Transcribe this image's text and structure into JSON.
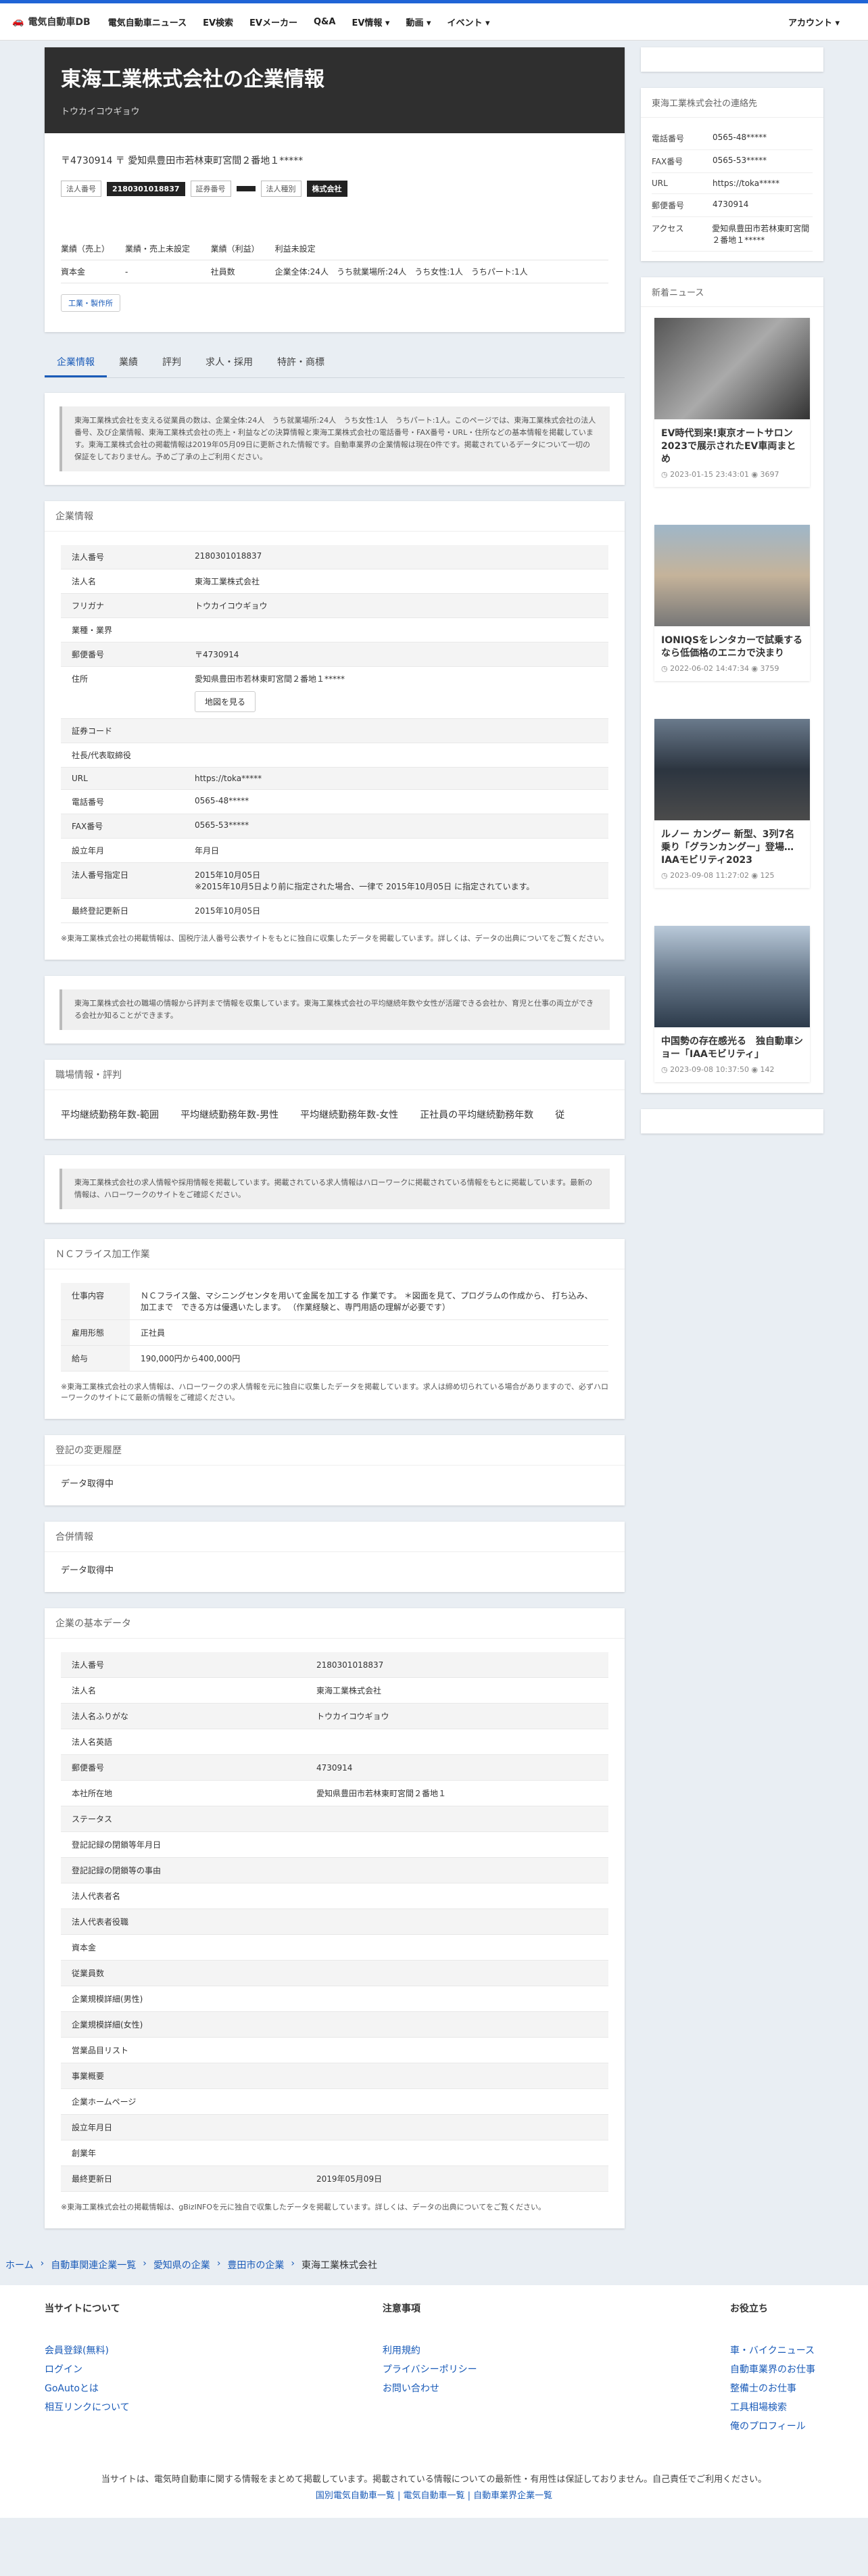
{
  "nav": {
    "brand": "電気自動車DB",
    "items": [
      "電気自動車ニュース",
      "EV検索",
      "EVメーカー",
      "Q&A",
      "EV情報 ▾",
      "動画 ▾",
      "イベント ▾"
    ],
    "account": "アカウント ▾"
  },
  "hero": {
    "title": "東海工業株式会社の企業情報",
    "kana": "トウカイコウギョウ"
  },
  "company_summary": {
    "address": "〒4730914 〒 愛知県豊田市若林東町宮間２番地１*****",
    "badges": [
      {
        "label": "法人番号",
        "value": "2180301018837"
      },
      {
        "label": "証券番号",
        "value": ""
      },
      {
        "label": "法人種別",
        "value": "株式会社"
      }
    ],
    "rows": [
      [
        "業績（売上）",
        "業績・売上未設定",
        "業績（利益）",
        "利益未設定"
      ],
      [
        "資本金",
        "-",
        "社員数",
        "企業全体:24人　うち就業場所:24人　うち女性:1人　うちパート:1人"
      ]
    ],
    "tag": "工業・製作所"
  },
  "tabs": [
    "企業情報",
    "業績",
    "評判",
    "求人・採用",
    "特許・商標"
  ],
  "notice1": "東海工業株式会社を支える従業員の数は、企業全体:24人　うち就業場所:24人　うち女性:1人　うちパート:1人。このページでは、東海工業株式会社の法人番号、及び企業情報、東海工業株式会社の売上・利益などの決算情報と東海工業株式会社の電話番号・FAX番号・URL・住所などの基本情報を掲載しています。東海工業株式会社の掲載情報は2019年05月09日に更新された情報です。自動車業界の企業情報は現在0件です。掲載されているデータについて一切の保証をしておりません。予めご了承の上ご利用ください。",
  "company_info": {
    "heading": "企業情報",
    "rows": [
      [
        "法人番号",
        "2180301018837"
      ],
      [
        "法人名",
        "東海工業株式会社"
      ],
      [
        "フリガナ",
        "トウカイコウギョウ"
      ],
      [
        "業種・業界",
        ""
      ],
      [
        "郵便番号",
        "〒4730914"
      ],
      [
        "住所",
        "愛知県豊田市若林東町宮間２番地１*****"
      ],
      [
        "証券コード",
        ""
      ],
      [
        "社長/代表取締役",
        ""
      ],
      [
        "URL",
        "https://toka*****"
      ],
      [
        "電話番号",
        "0565-48*****"
      ],
      [
        "FAX番号",
        "0565-53*****"
      ],
      [
        "設立年月",
        "年月日"
      ],
      [
        "法人番号指定日",
        "2015年10月05日\n※2015年10月5日より前に指定された場合、一律で 2015年10月05日 に指定されています。"
      ],
      [
        "最終登記更新日",
        "2015年10月05日"
      ]
    ],
    "map_button": "地図を見る",
    "note": "※東海工業株式会社の掲載情報は、国税庁法人番号公表サイトをもとに独自に収集したデータを掲載しています。詳しくは、データの出典についてをご覧ください。"
  },
  "notice2": "東海工業株式会社の職場の情報から評判まで情報を収集しています。東海工業株式会社の平均継続年数や女性が活躍できる会社か、育児と仕事の両立ができる会社か知ることができます。",
  "workplace": {
    "heading": "職場情報・評判",
    "items": [
      "平均継続勤務年数-範囲",
      "平均継続勤務年数-男性",
      "平均継続勤務年数-女性",
      "正社員の平均継続勤務年数",
      "従"
    ]
  },
  "notice3": "東海工業株式会社の求人情報や採用情報を掲載しています。掲載されている求人情報はハローワークに掲載されている情報をもとに掲載しています。最新の情報は、ハローワークのサイトをご確認ください。",
  "job": {
    "heading": "ＮＣフライス加工作業",
    "rows": [
      [
        "仕事内容",
        "ＮＣフライス盤、マシニングセンタを用いて金属を加工する 作業です。 ＊図面を見て、プログラムの作成から、 打ち込み、加工まで　できる方は優遇いたします。 （作業経験と、専門用語の理解が必要です）"
      ],
      [
        "雇用形態",
        "正社員"
      ],
      [
        "給与",
        "190,000円から400,000円"
      ]
    ],
    "note": "※東海工業株式会社の求人情報は、ハローワークの求人情報を元に独自に収集したデータを掲載しています。求人は締め切られている場合がありますので、必ずハローワークのサイトにて最新の情報をご確認ください。"
  },
  "registry": {
    "heading": "登記の変更履歴",
    "value": "データ取得中"
  },
  "merger": {
    "heading": "合併情報",
    "value": "データ取得中"
  },
  "basic": {
    "heading": "企業の基本データ",
    "rows": [
      [
        "法人番号",
        "2180301018837"
      ],
      [
        "法人名",
        "東海工業株式会社"
      ],
      [
        "法人名ふりがな",
        "トウカイコウギョウ"
      ],
      [
        "法人名英語",
        ""
      ],
      [
        "郵便番号",
        "4730914"
      ],
      [
        "本社所在地",
        "愛知県豊田市若林東町宮間２番地１"
      ],
      [
        "ステータス",
        ""
      ],
      [
        "登記記録の閉鎖等年月日",
        ""
      ],
      [
        "登記記録の閉鎖等の事由",
        ""
      ],
      [
        "法人代表者名",
        ""
      ],
      [
        "法人代表者役職",
        ""
      ],
      [
        "資本金",
        ""
      ],
      [
        "従業員数",
        ""
      ],
      [
        "企業規模詳細(男性)",
        ""
      ],
      [
        "企業規模詳細(女性)",
        ""
      ],
      [
        "営業品目リスト",
        ""
      ],
      [
        "事業概要",
        ""
      ],
      [
        "企業ホームページ",
        ""
      ],
      [
        "設立年月日",
        ""
      ],
      [
        "創業年",
        ""
      ],
      [
        "最終更新日",
        "2019年05月09日"
      ]
    ],
    "note": "※東海工業株式会社の掲載情報は、gBizINFOを元に独自で収集したデータを掲載しています。詳しくは、データの出典についてをご覧ください。"
  },
  "side_contact": {
    "heading": "東海工業株式会社の連絡先",
    "rows": [
      [
        "電話番号",
        "0565-48*****"
      ],
      [
        "FAX番号",
        "0565-53*****"
      ],
      [
        "URL",
        "https://toka*****"
      ],
      [
        "郵便番号",
        "4730914"
      ],
      [
        "アクセス",
        "愛知県豊田市若林東町宮間２番地１*****"
      ]
    ]
  },
  "news": {
    "heading": "新着ニュース",
    "items": [
      {
        "title": "EV時代到来!東京オートサロン2023で展示されたEV車両まとめ",
        "date": "2023-01-15 23:43:01",
        "views": "3697"
      },
      {
        "title": "IONIQSをレンタカーで試乗するなら低価格のエニカで決まり",
        "date": "2022-06-02 14:47:34",
        "views": "3759"
      },
      {
        "title": "ルノー カングー 新型、3列7名乗り「グランカングー」登場…IAAモビリティ2023",
        "date": "2023-09-08 11:27:02",
        "views": "125"
      },
      {
        "title": "中国勢の存在感光る　独自動車ショー「IAAモビリティ」",
        "date": "2023-09-08 10:37:50",
        "views": "142"
      }
    ]
  },
  "breadcrumbs": [
    "ホーム",
    "自動車関連企業一覧",
    "愛知県の企業",
    "豊田市の企業",
    "東海工業株式会社"
  ],
  "footer": {
    "cols": [
      {
        "title": "当サイトについて",
        "links": [
          "会員登録(無料)",
          "ログイン",
          "GoAutoとは",
          "相互リンクについて"
        ]
      },
      {
        "title": "注意事項",
        "links": [
          "利用規約",
          "プライバシーポリシー",
          "お問い合わせ"
        ]
      },
      {
        "title": "お役立ち",
        "links": [
          "車・バイクニュース",
          "自動車業界のお仕事",
          "整備士のお仕事",
          "工具相場検索",
          "俺のプロフィール"
        ]
      }
    ],
    "copy": "当サイトは、電気時自動車に関する情報をまとめて掲載しています。掲載されている情報についての最新性・有用性は保証しておりません。自己責任でご利用ください。",
    "links": "国別電気自動車一覧 | 電気自動車一覧 | 自動車業界企業一覧"
  }
}
